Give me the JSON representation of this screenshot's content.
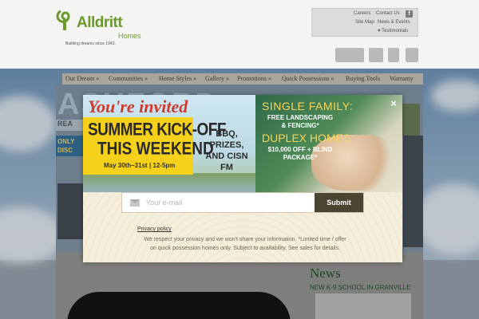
{
  "brand": {
    "name": "Alldritt",
    "sub": "Homes",
    "tagline": "Building dreams since 1943.",
    "color": "#6a9a2c"
  },
  "top_links": {
    "careers": "Careers",
    "contact": "Contact Us",
    "sitemap": "Site Map",
    "news": "News & Events",
    "testimonials": "♥ Testimonials",
    "facebook_icon": "f"
  },
  "nav": {
    "items": [
      "Our Dream »",
      "Communities »",
      "Home Styles »",
      "Gallery »",
      "Promotions »",
      "Quick Possessions »",
      "Buying Tools",
      "Warranty"
    ]
  },
  "hero": {
    "bg_text": "ASHFORD",
    "strip1": "REA",
    "strip2_line1": "ONLY",
    "strip2_line2": "DISC"
  },
  "news": {
    "title": "News",
    "item": "NEW K-9 SCHOOL IN GRANVILLE"
  },
  "modal": {
    "close": "×",
    "promo_left": {
      "invited": "You're invited",
      "kickoff_line1": "SUMMER KICK-OFF",
      "kickoff_line2": "THIS WEEKEND",
      "dates": "May 30th–31st | 12-5pm",
      "extras": "BBQ, PRIZES, AND CISN FM"
    },
    "promo_right": {
      "single": "SINGLE FAMILY:",
      "landscaping": "FREE LANDSCAPING & FENCING*",
      "duplex": "DUPLEX HOMES:",
      "blinds": "$10,000 OFF + BLIND PACKAGE*"
    },
    "email_placeholder": "Your e-mail",
    "submit": "Submit",
    "privacy_link": "Privacy policy",
    "disclaimer": "We respect your privacy and we won't share your information. *Limited time / offer on quick possession homes only. Subject to availability. See sales for details."
  }
}
